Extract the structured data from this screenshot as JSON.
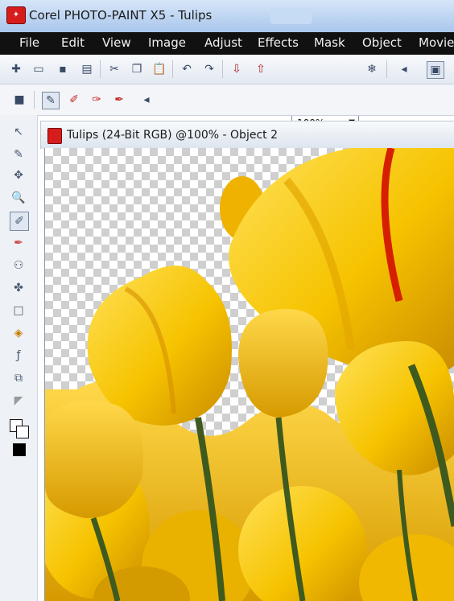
{
  "window": {
    "title": "Corel PHOTO-PAINT X5 - Tulips"
  },
  "menu": {
    "items": [
      "File",
      "Edit",
      "View",
      "Image",
      "Adjust",
      "Effects",
      "Mask",
      "Object",
      "Movie"
    ]
  },
  "toolbar": {
    "zoom_value": "100%"
  },
  "document": {
    "tab_title": "Tulips (24-Bit RGB) @100% - Object 2"
  },
  "colors": {
    "titlebar": "#c6dbf4",
    "menubar": "#111111",
    "tulip_yellow": "#f6c300",
    "tulip_red": "#d61f00",
    "stem": "#3f5a1e"
  },
  "icons": {
    "toolbar": [
      "new-icon",
      "open-icon",
      "save-icon",
      "print-icon",
      "cut-icon",
      "copy-icon",
      "paste-icon",
      "undo-icon",
      "redo-icon",
      "import-icon",
      "export-icon",
      "zoom-icon",
      "options-icon"
    ],
    "left_tools": [
      "pick-icon",
      "freehand-icon",
      "crop-icon",
      "zoom-tool-icon",
      "eyedropper-icon",
      "paint-icon",
      "clone-icon",
      "effect-icon",
      "rectangle-icon",
      "fill-icon",
      "text-icon",
      "transparency-icon",
      "color-icon"
    ]
  }
}
